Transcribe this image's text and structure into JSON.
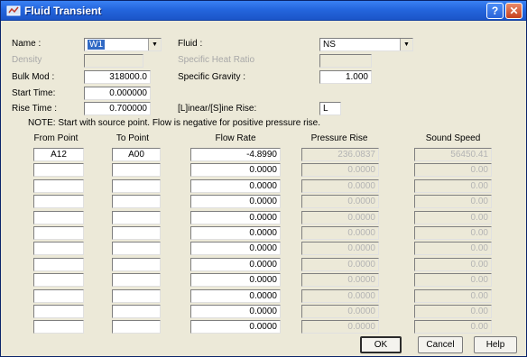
{
  "window": {
    "title": "Fluid Transient",
    "help_glyph": "?",
    "close_glyph": "✕"
  },
  "form": {
    "name_label": "Name :",
    "name_value": "W1",
    "fluid_label": "Fluid :",
    "fluid_value": "NS",
    "density_label": "Density",
    "specific_heat_ratio_label": "Specific Heat Ratio",
    "bulk_mod_label": "Bulk Mod :",
    "bulk_mod_value": "318000.0",
    "specific_gravity_label": "Specific Gravity  :",
    "specific_gravity_value": "1.000",
    "start_time_label": "Start Time:",
    "start_time_value": "0.000000",
    "rise_time_label": "Rise Time :",
    "rise_time_value": "0.700000",
    "linear_sine_label": "[L]inear/[S]ine Rise:",
    "linear_sine_value": "L",
    "note": "NOTE: Start with source point. Flow is negative for positive pressure rise."
  },
  "table": {
    "headers": [
      "From Point",
      "To Point",
      "Flow Rate",
      "Pressure Rise",
      "Sound Speed"
    ],
    "rows": [
      [
        "A12",
        "A00",
        "-4.8990",
        "236.0837",
        "56450.41"
      ],
      [
        "",
        "",
        "0.0000",
        "0.0000",
        "0.00"
      ],
      [
        "",
        "",
        "0.0000",
        "0.0000",
        "0.00"
      ],
      [
        "",
        "",
        "0.0000",
        "0.0000",
        "0.00"
      ],
      [
        "",
        "",
        "0.0000",
        "0.0000",
        "0.00"
      ],
      [
        "",
        "",
        "0.0000",
        "0.0000",
        "0.00"
      ],
      [
        "",
        "",
        "0.0000",
        "0.0000",
        "0.00"
      ],
      [
        "",
        "",
        "0.0000",
        "0.0000",
        "0.00"
      ],
      [
        "",
        "",
        "0.0000",
        "0.0000",
        "0.00"
      ],
      [
        "",
        "",
        "0.0000",
        "0.0000",
        "0.00"
      ],
      [
        "",
        "",
        "0.0000",
        "0.0000",
        "0.00"
      ],
      [
        "",
        "",
        "0.0000",
        "0.0000",
        "0.00"
      ]
    ]
  },
  "buttons": {
    "ok": "OK",
    "cancel": "Cancel",
    "help": "Help"
  },
  "icons": {
    "title_icon": "fluid-icon",
    "dropdown": "chevron-down-icon"
  }
}
